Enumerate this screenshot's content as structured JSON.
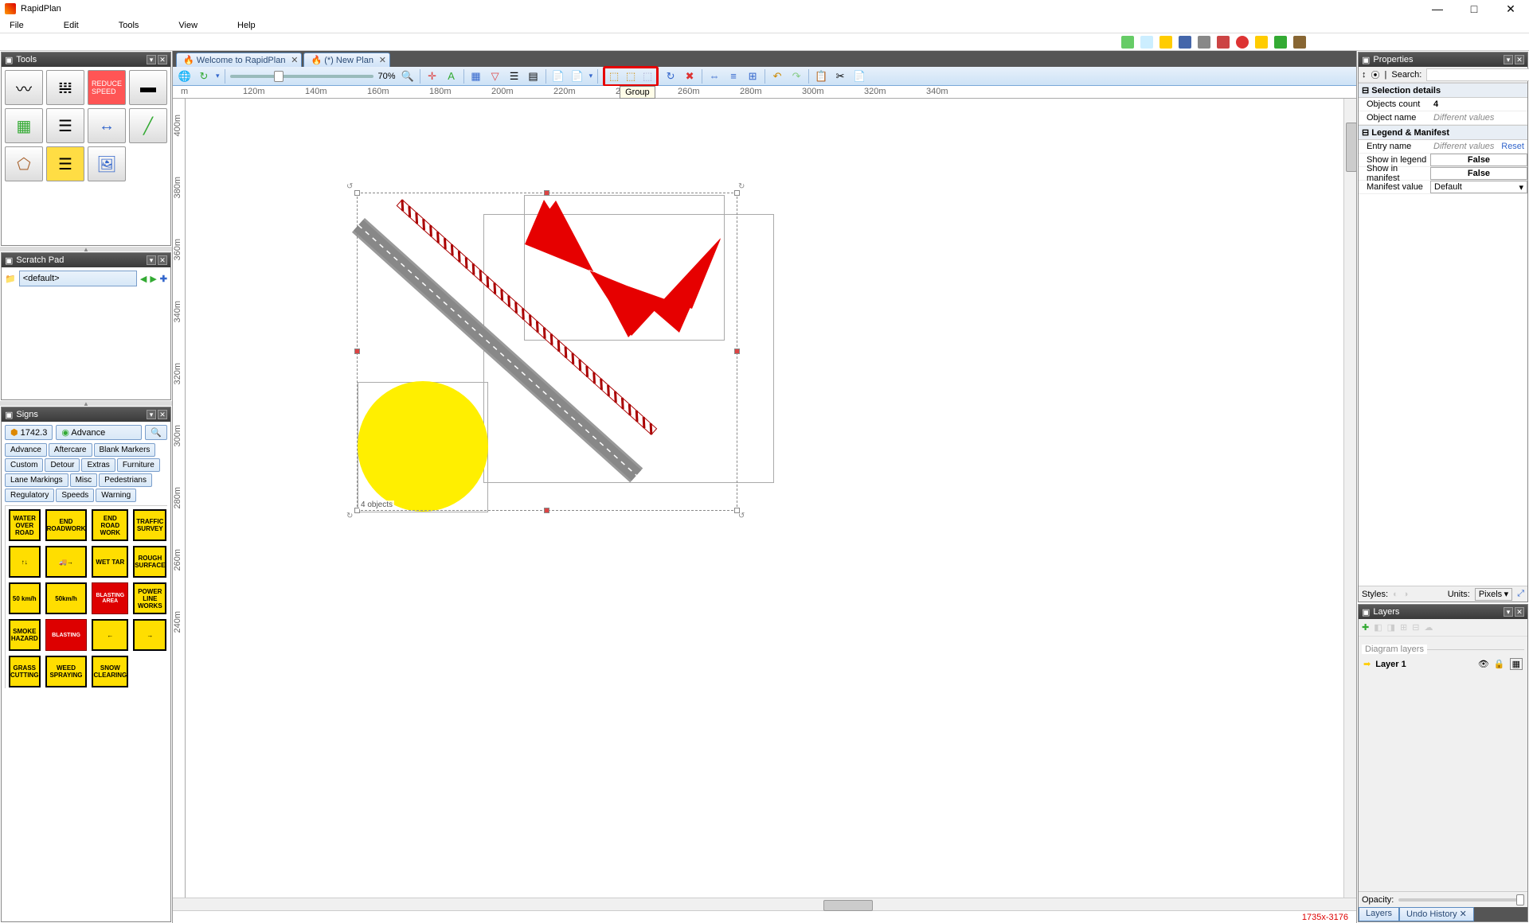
{
  "app": {
    "title": "RapidPlan"
  },
  "window_controls": {
    "min": "—",
    "max": "□",
    "close": "✕"
  },
  "menubar": [
    "File",
    "Edit",
    "Tools",
    "View",
    "Help"
  ],
  "doc_tabs": [
    {
      "icon": "🔥",
      "label": "Welcome to RapidPlan"
    },
    {
      "icon": "🔥",
      "label": "(*) New Plan"
    }
  ],
  "canvas_toolbar": {
    "zoom_pct": "70%",
    "tooltip": "Group"
  },
  "ruler_h": [
    "m",
    "120m",
    "140m",
    "160m",
    "180m",
    "200m",
    "220m",
    "240m",
    "260m",
    "280m",
    "300m",
    "320m",
    "340m"
  ],
  "ruler_v": [
    "400m",
    "380m",
    "360m",
    "340m",
    "320m",
    "300m",
    "280m",
    "260m",
    "240m"
  ],
  "selection_label": "4 objects",
  "statusbar": {
    "coords": "1735x-3176"
  },
  "properties": {
    "title": "Properties",
    "search_label": "Search:",
    "sections": {
      "selection": {
        "title": "Selection details",
        "rows": [
          {
            "label": "Objects count",
            "value": "4"
          },
          {
            "label": "Object name",
            "value": "Different values",
            "italic": true
          }
        ]
      },
      "legend": {
        "title": "Legend & Manifest",
        "rows": [
          {
            "label": "Entry name",
            "value": "Different values",
            "italic": true,
            "reset": "Reset"
          },
          {
            "label": "Show in legend",
            "value": "False",
            "boxed": true
          },
          {
            "label": "Show in manifest",
            "value": "False",
            "boxed": true
          },
          {
            "label": "Manifest value",
            "value": "Default",
            "select": true
          }
        ]
      }
    },
    "styles_label": "Styles:",
    "units_label": "Units:",
    "units_value": "Pixels"
  },
  "layers": {
    "title": "Layers",
    "section_label": "Diagram layers",
    "items": [
      {
        "name": "Layer 1"
      }
    ],
    "opacity_label": "Opacity:",
    "bottom_tabs": [
      "Layers",
      "Undo History"
    ]
  },
  "tools_panel": {
    "title": "Tools"
  },
  "scratch": {
    "title": "Scratch Pad",
    "default": "<default>"
  },
  "signs": {
    "title": "Signs",
    "count": "1742.3",
    "current": "Advance",
    "categories": [
      "Advance",
      "Aftercare",
      "Blank Markers",
      "Custom",
      "Detour",
      "Extras",
      "Furniture",
      "Lane Markings",
      "Misc",
      "Pedestrians",
      "Regulatory",
      "Speeds",
      "Warning"
    ],
    "items": [
      {
        "text": "WATER OVER ROAD",
        "cls": "yellow"
      },
      {
        "text": "END ROADWORK",
        "cls": "yellow"
      },
      {
        "text": "END ROAD WORK",
        "cls": "yellow"
      },
      {
        "text": "TRAFFIC SURVEY",
        "cls": "yellow"
      },
      {
        "text": "↑↓",
        "cls": "yellow"
      },
      {
        "text": "🚚→",
        "cls": "yellow"
      },
      {
        "text": "WET TAR",
        "cls": "yellow"
      },
      {
        "text": "ROUGH SURFACE",
        "cls": "yellow"
      },
      {
        "text": "50 km/h",
        "cls": "yellow"
      },
      {
        "text": "50km/h",
        "cls": "yellow"
      },
      {
        "text": "BLASTING AREA",
        "cls": "red"
      },
      {
        "text": "POWER LINE WORKS",
        "cls": "yellow"
      },
      {
        "text": "SMOKE HAZARD",
        "cls": "yellow"
      },
      {
        "text": "BLASTING",
        "cls": "red"
      },
      {
        "text": "←",
        "cls": "yellow"
      },
      {
        "text": "→",
        "cls": "yellow"
      },
      {
        "text": "GRASS CUTTING",
        "cls": "yellow"
      },
      {
        "text": "WEED SPRAYING",
        "cls": "yellow"
      },
      {
        "text": "SNOW CLEARING",
        "cls": "yellow"
      },
      {
        "text": "",
        "cls": ""
      }
    ]
  }
}
